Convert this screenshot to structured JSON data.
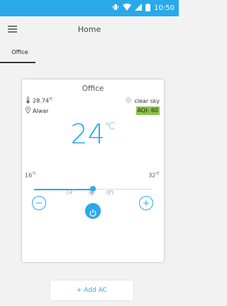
{
  "status_bar": {
    "time": "10:50",
    "icons": [
      "vibrate-icon",
      "wifi-icon",
      "signal-icon",
      "battery-icon"
    ]
  },
  "app_bar": {
    "title": "Home",
    "menu_icon": "hamburger-icon"
  },
  "tabs": [
    {
      "label": "Office",
      "selected": true
    }
  ],
  "card": {
    "room": "Office",
    "outdoor_temp": "28.74",
    "outdoor_unit": "℃",
    "location": "Alwar",
    "weather": "clear sky",
    "aqi": "AQI: 60",
    "set_temp": "24",
    "set_unit": "℃",
    "min_temp": "16",
    "max_temp": "32",
    "temp_unit": "℃",
    "slider_value": 24,
    "slider_min": 16,
    "slider_max": 32,
    "mode_temp": "24",
    "mode_icons": [
      "snowflake-icon",
      "fan-icon"
    ],
    "accent_color": "#29a9ea"
  },
  "add_button": {
    "label": "+ Add AC"
  }
}
